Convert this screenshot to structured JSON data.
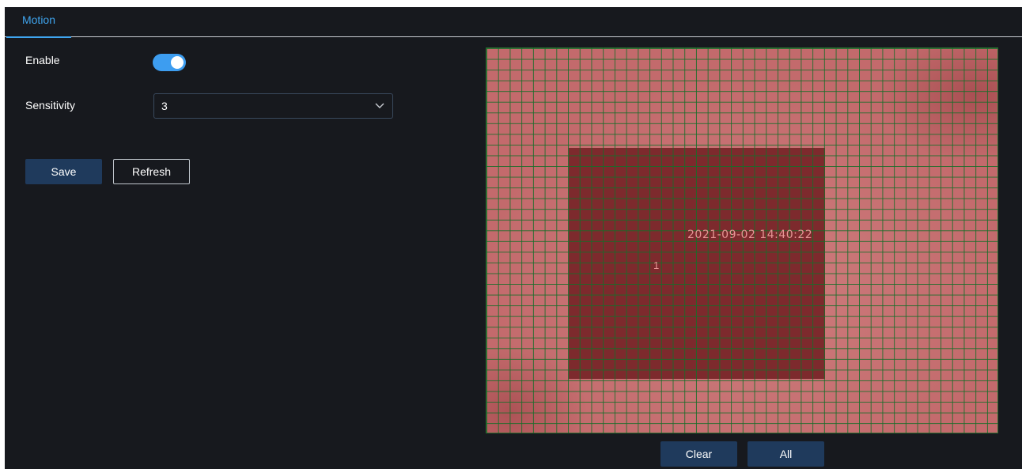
{
  "tabs": [
    {
      "label": "Motion",
      "active": true
    }
  ],
  "form": {
    "enable_label": "Enable",
    "enable_value": true,
    "sensitivity_label": "Sensitivity",
    "sensitivity_value": "3"
  },
  "actions": {
    "save_label": "Save",
    "refresh_label": "Refresh"
  },
  "video": {
    "timestamp": "2021-09-02 14:40:22",
    "channel": "1",
    "grid_columns": 44,
    "grid_rows": 36
  },
  "grid_actions": {
    "clear_label": "Clear",
    "all_label": "All"
  },
  "colors": {
    "accent": "#3fa5ef",
    "background": "#17191e",
    "button": "#1f3a5c",
    "grid_line": "#146e28",
    "region": "#7d2a2d"
  },
  "icons": {
    "select_arrow": "chevron-down-icon"
  }
}
